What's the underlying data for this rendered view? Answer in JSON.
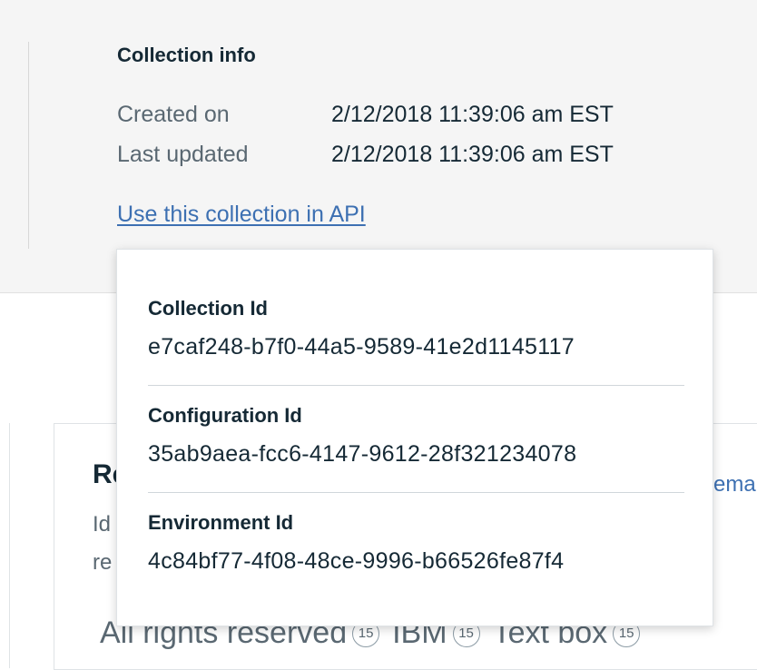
{
  "collection_info": {
    "title": "Collection info",
    "created_label": "Created on",
    "created_value": "2/12/2018 11:39:06 am EST",
    "updated_label": "Last updated",
    "updated_value": "2/12/2018 11:39:06 am EST",
    "api_link": "Use this collection in API"
  },
  "popover": {
    "collection_id_label": "Collection Id",
    "collection_id_value": "e7caf248-b7f0-44a5-9589-41e2d1145117",
    "configuration_id_label": "Configuration Id",
    "configuration_id_value": "35ab9aea-fcc6-4147-9612-28f321234078",
    "environment_id_label": "Environment Id",
    "environment_id_value": "4c84bf77-4f08-48ce-9996-b66526fe87f4"
  },
  "background_card": {
    "title": "Re",
    "line1": "Id",
    "line2": "re",
    "link": "ema",
    "tags": [
      {
        "label": "All rights reserved",
        "count": "15"
      },
      {
        "label": "IBM",
        "count": "15"
      },
      {
        "label": "Text box",
        "count": "15"
      }
    ]
  },
  "colors": {
    "link": "#3d70b2",
    "panel_background": "#f5f5f5",
    "text_primary": "#152935",
    "text_secondary": "#5a6872"
  }
}
